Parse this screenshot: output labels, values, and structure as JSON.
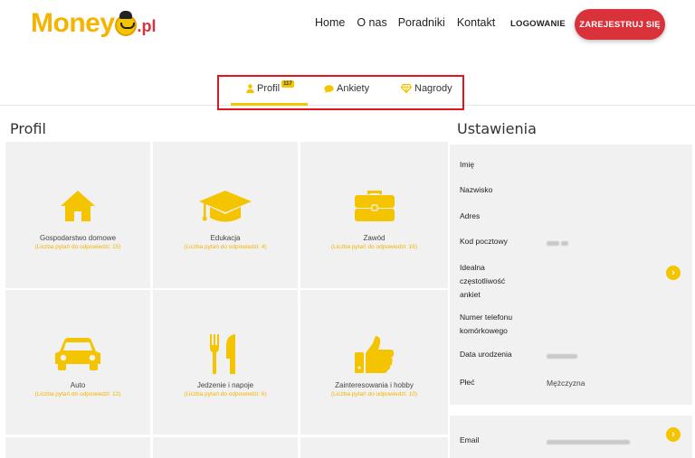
{
  "header": {
    "logo_main": "Money",
    "logo_tld": ".pl",
    "nav": [
      "Home",
      "O nas",
      "Poradniki",
      "Kontakt"
    ],
    "login_label": "LOGOWANIE",
    "register_label": "ZAREJESTRUJ SIĘ"
  },
  "tabs": [
    {
      "label": "Profil",
      "badge": "117",
      "icon": "user-icon"
    },
    {
      "label": "Ankiety",
      "icon": "chat-icon"
    },
    {
      "label": "Nagrody",
      "icon": "diamond-icon"
    }
  ],
  "profil": {
    "title": "Profil",
    "cards": [
      {
        "label": "Gospodarstwo domowe",
        "sub": "(Liczba pytań do odpowiedzi: 15)",
        "icon": "house-icon"
      },
      {
        "label": "Edukacja",
        "sub": "(Liczba pytań do odpowiedzi: 4)",
        "icon": "graduation-cap-icon"
      },
      {
        "label": "Zawód",
        "sub": "(Liczba pytań do odpowiedzi: 16)",
        "icon": "briefcase-icon"
      },
      {
        "label": "Auto",
        "sub": "(Liczba pytań do odpowiedzi: 12)",
        "icon": "car-icon"
      },
      {
        "label": "Jedzenie i napoje",
        "sub": "(Liczba pytań do odpowiedzi: 6)",
        "icon": "fork-knife-icon"
      },
      {
        "label": "Zainteresowania i hobby",
        "sub": "(Liczba pytań do odpowiedzi: 10)",
        "icon": "thumbs-up-icon"
      }
    ]
  },
  "settings": {
    "title": "Ustawienia",
    "rows": [
      {
        "label": "Imię",
        "value": ""
      },
      {
        "label": "Nazwisko",
        "value": ""
      },
      {
        "label": "Adres",
        "value": ""
      },
      {
        "label": "Kod pocztowy",
        "value": "",
        "blurred": true
      },
      {
        "label": "Idealna częstotliwość ankiet",
        "value": ""
      },
      {
        "label": "Numer telefonu komórkowego",
        "value": ""
      },
      {
        "label": "Data urodzenia",
        "value": "",
        "blurred": true
      },
      {
        "label": "Płeć",
        "value": "Mężczyzna"
      },
      {
        "label": "Email",
        "value": "",
        "blurred": true
      }
    ]
  },
  "colors": {
    "accent": "#f5c400",
    "brand_red": "#d9323a",
    "highlight_box": "#e0161e",
    "card_bg": "#f1f1f1"
  }
}
